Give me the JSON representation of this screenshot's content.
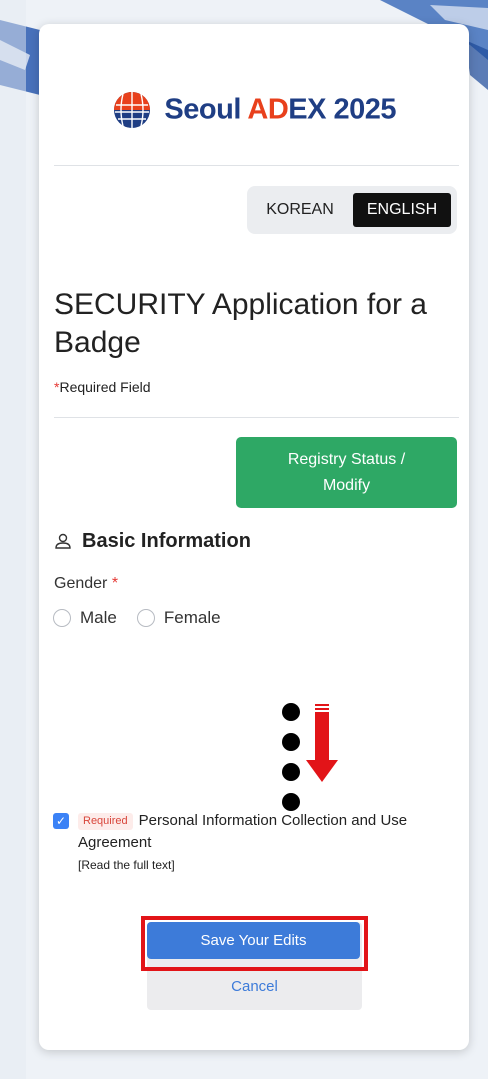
{
  "header": {
    "brand_word1": "Seoul ",
    "brand_word2_accent": "AD",
    "brand_word2_rest": "EX",
    "brand_year": " 2025"
  },
  "language": {
    "korean": "KOREAN",
    "english": "ENGLISH",
    "selected": "ENGLISH"
  },
  "form": {
    "title": "SECURITY Application for a Badge",
    "required_star": "*",
    "required_note": "Required Field",
    "status_button": "Registry Status / Modify",
    "section_title": "Basic Information",
    "gender_label": "Gender",
    "gender_star": "*",
    "gender_options": [
      "Male",
      "Female"
    ],
    "consent": {
      "checked": true,
      "badge": "Required",
      "text": "Personal Information Collection and Use Agreement",
      "link": "[Read the full text]"
    },
    "save_button": "Save Your Edits",
    "cancel_button": "Cancel"
  },
  "colors": {
    "brand_blue": "#1f3e84",
    "brand_accent": "#e8401c",
    "status_green": "#2ea865",
    "primary_blue": "#3d7bd9",
    "highlight_red": "#e21418"
  },
  "icons": [
    "globe-logo-icon",
    "user-icon",
    "checkmark-icon",
    "down-arrow-icon"
  ]
}
